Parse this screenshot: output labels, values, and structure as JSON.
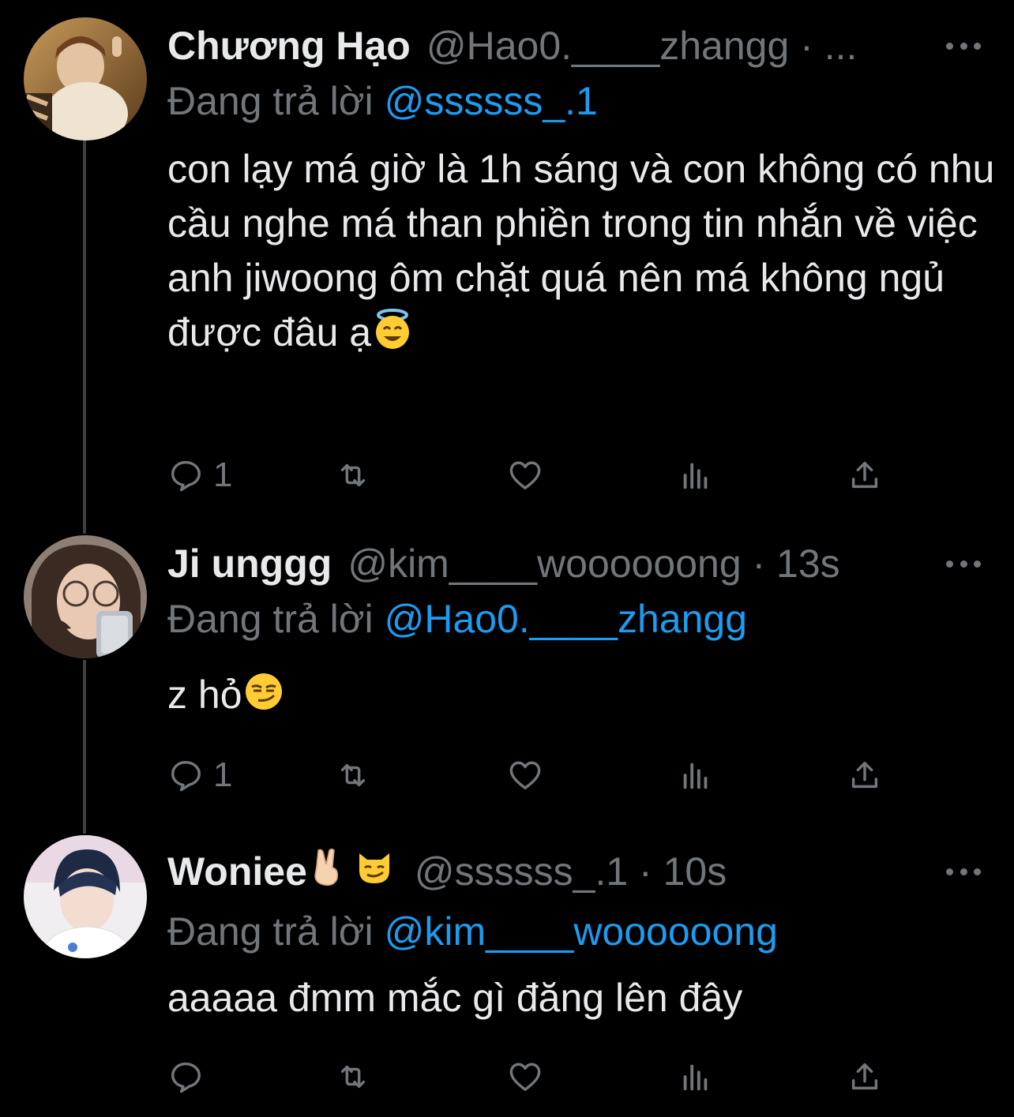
{
  "tweets": [
    {
      "display_name": "Chương Hạo",
      "handle_time": "@Hao0.____zhangg · ...",
      "reply_prefix": "Đang trả lời",
      "reply_to": "@ssssss_.1",
      "text": "con lạy má giờ là 1h sáng và con không có nhu cầu nghe má than phiền trong tin nhắn về việc anh jiwoong ôm chặt quá nên má không ngủ được đâu ạ",
      "reply_count": "1"
    },
    {
      "display_name": "Ji unggg",
      "handle_time": "@kim____woooooong · 13s",
      "reply_prefix": "Đang trả lời",
      "reply_to": "@Hao0.____zhangg",
      "text": "z hỏ",
      "reply_count": "1"
    },
    {
      "display_name": "Woniee",
      "handle_time": "@ssssss_.1 · 10s",
      "reply_prefix": "Đang trả lời",
      "reply_to": "@kim____woooooong",
      "text": "aaaaa đmm mắc gì đăng lên đây",
      "reply_count": ""
    }
  ],
  "colors": {
    "background": "#000000",
    "text": "#e7e9ea",
    "secondary": "#71767b",
    "accent": "#1d9bf0"
  },
  "icons": [
    "reply-icon",
    "retweet-icon",
    "like-icon",
    "views-icon",
    "share-icon",
    "more-icon"
  ]
}
